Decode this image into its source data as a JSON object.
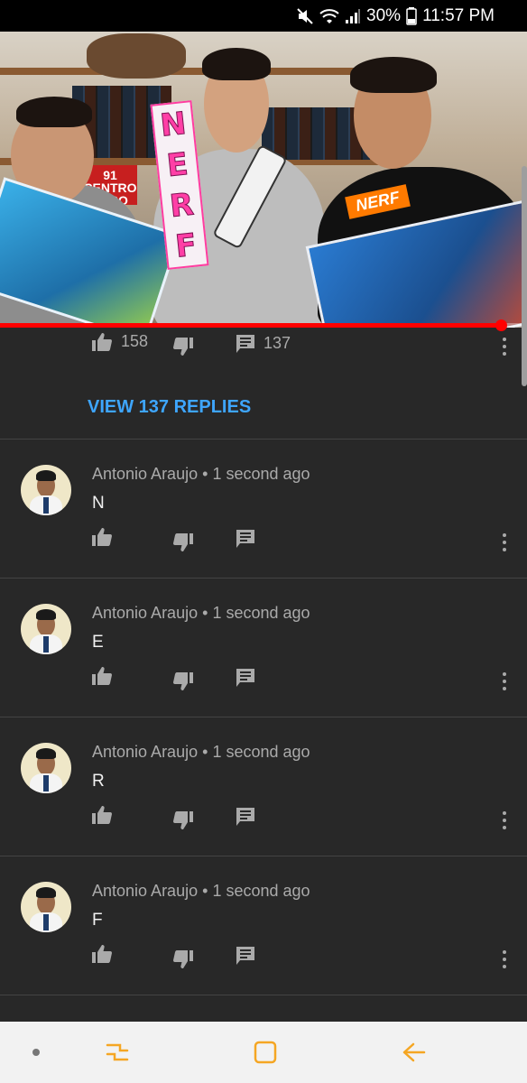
{
  "status_bar": {
    "battery": "30%",
    "time": "11:57 PM",
    "icons": [
      "mute-icon",
      "wifi-icon",
      "signal-icon",
      "battery-icon"
    ]
  },
  "video": {
    "sign_letters": [
      "N",
      "E",
      "R",
      "F"
    ],
    "box_logo": "NERF",
    "poster_text": "91\nCENTRO\nPERO",
    "progress_fraction": 0.95
  },
  "parent_comment": {
    "likes": "158",
    "replies_count": "137",
    "view_replies_label": "VIEW 137 REPLIES"
  },
  "comments": [
    {
      "author": "Antonio Araujo",
      "time": "1 second ago",
      "text": "N"
    },
    {
      "author": "Antonio Araujo",
      "time": "1 second ago",
      "text": "E"
    },
    {
      "author": "Antonio Araujo",
      "time": "1 second ago",
      "text": "R"
    },
    {
      "author": "Antonio Araujo",
      "time": "1 second ago",
      "text": "F"
    }
  ],
  "separator": "•",
  "nav_bar": {
    "items": [
      "dot-icon",
      "recent-apps-icon",
      "home-icon",
      "back-icon"
    ],
    "accent": "#f5a623"
  },
  "colors": {
    "background": "#282828",
    "link": "#3ea6ff",
    "progress": "#ff0000"
  }
}
